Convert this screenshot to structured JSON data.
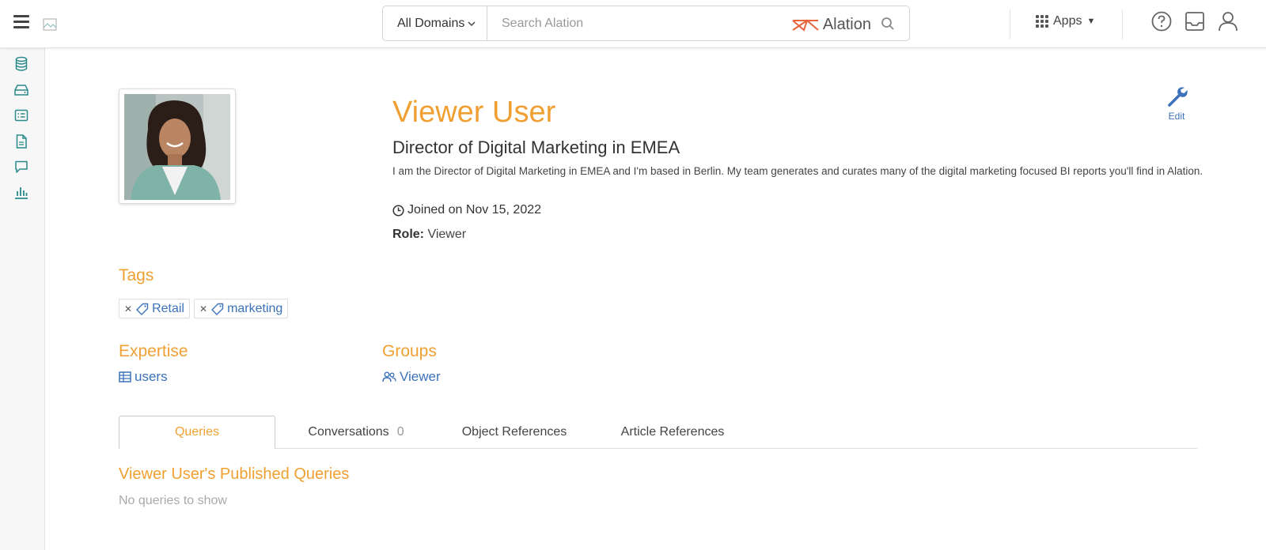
{
  "header": {
    "domain_select": "All Domains",
    "search_placeholder": "Search Alation",
    "brand": "Alation",
    "apps_label": "Apps"
  },
  "sidebar": {
    "items": [
      "database-icon",
      "storage-icon",
      "catalog-icon",
      "document-icon",
      "conversation-icon",
      "chart-icon"
    ]
  },
  "profile": {
    "name": "Viewer User",
    "title": "Director of Digital Marketing in EMEA",
    "bio": "I am the Director of Digital Marketing in EMEA and I'm based in Berlin. My team generates and curates many of the digital marketing focused BI reports you'll find in Alation.",
    "joined": "Joined on Nov 15, 2022",
    "role_label": "Role:",
    "role_value": "Viewer",
    "edit_label": "Edit"
  },
  "tags": {
    "heading": "Tags",
    "items": [
      "Retail",
      "marketing"
    ]
  },
  "expertise": {
    "heading": "Expertise",
    "items": [
      "users"
    ]
  },
  "groups": {
    "heading": "Groups",
    "items": [
      "Viewer"
    ]
  },
  "tabs": [
    {
      "label": "Queries",
      "count": ""
    },
    {
      "label": "Conversations",
      "count": "0"
    },
    {
      "label": "Object References",
      "count": ""
    },
    {
      "label": "Article References",
      "count": ""
    }
  ],
  "queries": {
    "heading": "Viewer User's Published Queries",
    "empty": "No queries to show"
  },
  "colors": {
    "accent": "#f0a032",
    "link": "#3b72b9",
    "teal_icons": "#2a8a8a"
  }
}
